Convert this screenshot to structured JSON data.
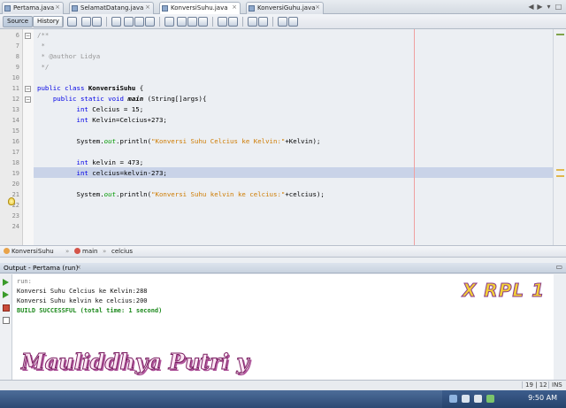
{
  "tabs": [
    "Pertama.java",
    "SelamatDatang.java",
    "KonversiSuhu.java",
    "KonversiGuhu.java"
  ],
  "active_tab": 2,
  "toolbar": {
    "source_label": "Source",
    "history_label": "History"
  },
  "editor": {
    "line_numbers": [
      "6",
      "7",
      "8",
      "9",
      "10",
      "11",
      "12",
      "13",
      "14",
      "15",
      "16",
      "17",
      "18",
      "19",
      "20",
      "21",
      "22",
      "23",
      "24"
    ],
    "lines": {
      "l6": "/**",
      "l7": " *",
      "l8": " * @author Lidya",
      "l9": " */",
      "l11_class": "KonversiSuhu",
      "l12_main": "main",
      "l12_rest": " (String[]args){",
      "l13": " Celcius = 15;",
      "l14": " Kelvin=Celcius+273;",
      "l16_pre": "System.",
      "l16_out": "out",
      "l16_mid": ".println(",
      "l16_str": "\"Konversi Suhu Celcius ke Kelvin:\"",
      "l16_post": "+Kelvin);",
      "l18": " kelvin = 473;",
      "l19": " celcius=kelvin-273;",
      "l21_pre": "System.",
      "l21_out": "out",
      "l21_mid": ".println(",
      "l21_str": "\"Konversi Suhu kelvin ke celcius:\"",
      "l21_post": "+celcius);"
    },
    "kw": {
      "public": "public",
      "class": "class",
      "static": "static",
      "void": "void",
      "int": "int"
    }
  },
  "breadcrumbs": [
    "KonversiSuhu",
    "main",
    "celcius"
  ],
  "output": {
    "title": "Output - Pertama (run)",
    "close": "×",
    "lines": [
      "run:",
      "Konversi Suhu Celcius ke Kelvin:288",
      "Konversi Suhu kelvin ke celcius:200"
    ],
    "success": "BUILD SUCCESSFUL (total time: 1 second)"
  },
  "overlay": {
    "class_text": "X RPL 1",
    "name_text": "Mauliddhya Putri y"
  },
  "status": {
    "position": "19 | 12",
    "mode": "INS"
  },
  "clock": "9:50 AM",
  "colors": {
    "keyword": "#0000e6",
    "string": "#ce7b00",
    "comment": "#969696",
    "success": "#1e8a1e",
    "highlight": "#c9d3e8"
  }
}
